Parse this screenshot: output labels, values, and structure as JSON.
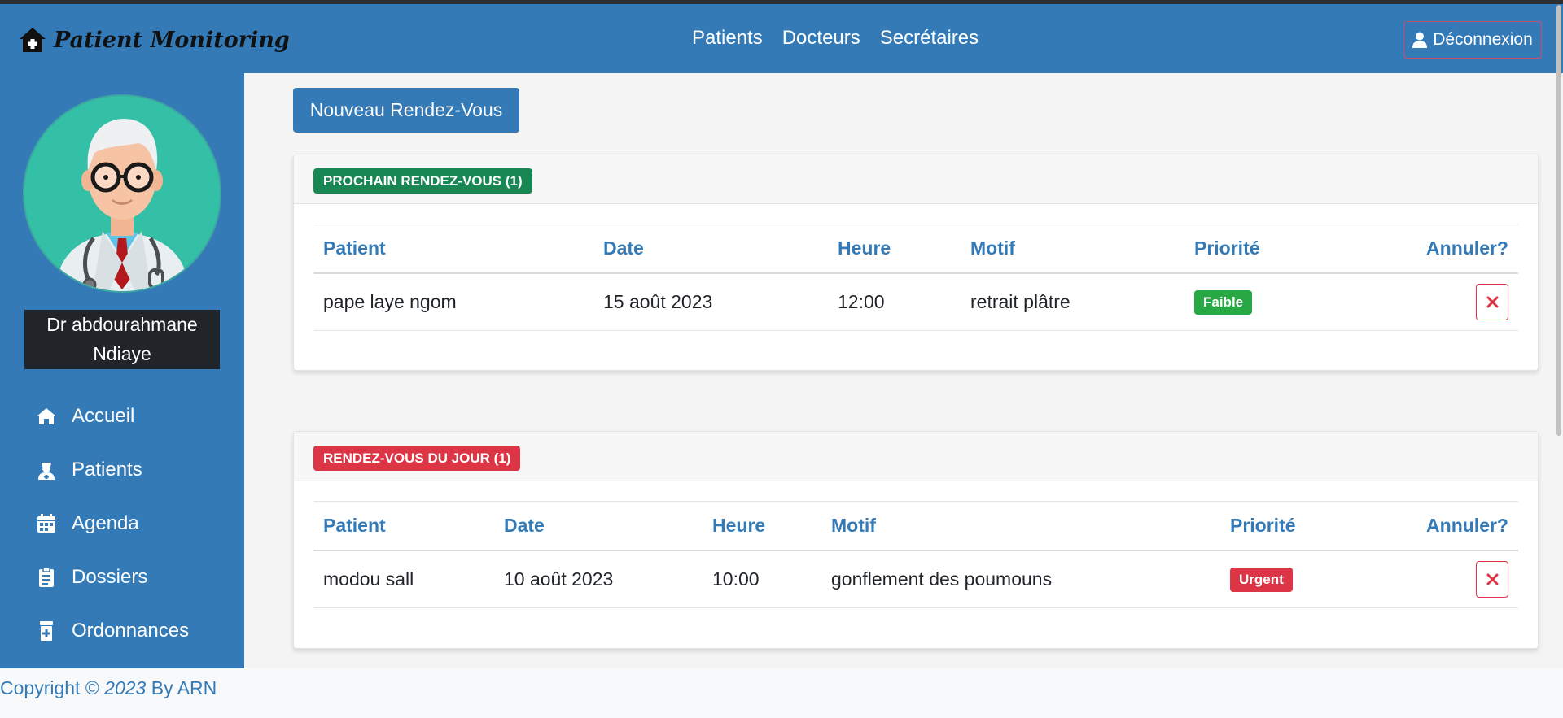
{
  "app": {
    "title": "Patient Monitoring"
  },
  "nav": {
    "links": [
      "Patients",
      "Docteurs",
      "Secrétaires"
    ],
    "logout_label": "Déconnexion"
  },
  "sidebar": {
    "doctor_name_line1": "Dr abdourahmane",
    "doctor_name_line2": "Ndiaye",
    "items": [
      {
        "label": "Accueil",
        "icon": "home-icon"
      },
      {
        "label": "Patients",
        "icon": "user-nurse-icon"
      },
      {
        "label": "Agenda",
        "icon": "calendar-icon"
      },
      {
        "label": "Dossiers",
        "icon": "clipboard-icon"
      },
      {
        "label": "Ordonnances",
        "icon": "prescription-icon"
      }
    ]
  },
  "main": {
    "new_button_label": "Nouveau Rendez-Vous",
    "upcoming": {
      "badge": "PROCHAIN RENDEZ-VOUS (1)",
      "columns": [
        "Patient",
        "Date",
        "Heure",
        "Motif",
        "Priorité",
        "Annuler?"
      ],
      "rows": [
        {
          "patient": "pape laye ngom",
          "date": "15 août 2023",
          "time": "12:00",
          "reason": "retrait plâtre",
          "priority": "Faible"
        }
      ]
    },
    "today": {
      "badge": "RENDEZ-VOUS DU JOUR (1)",
      "columns": [
        "Patient",
        "Date",
        "Heure",
        "Motif",
        "Priorité",
        "Annuler?"
      ],
      "rows": [
        {
          "patient": "modou sall",
          "date": "10 août 2023",
          "time": "10:00",
          "reason": "gonflement des poumouns",
          "priority": "Urgent"
        }
      ]
    }
  },
  "footer": {
    "prefix": "Copyright © ",
    "year": "2023",
    "suffix": " By ARN"
  },
  "colors": {
    "primary": "#337ab7",
    "success": "#198754",
    "success_pill": "#28a745",
    "danger": "#dc3545",
    "dark": "#212529",
    "avatar_bg": "#33c0a7"
  }
}
